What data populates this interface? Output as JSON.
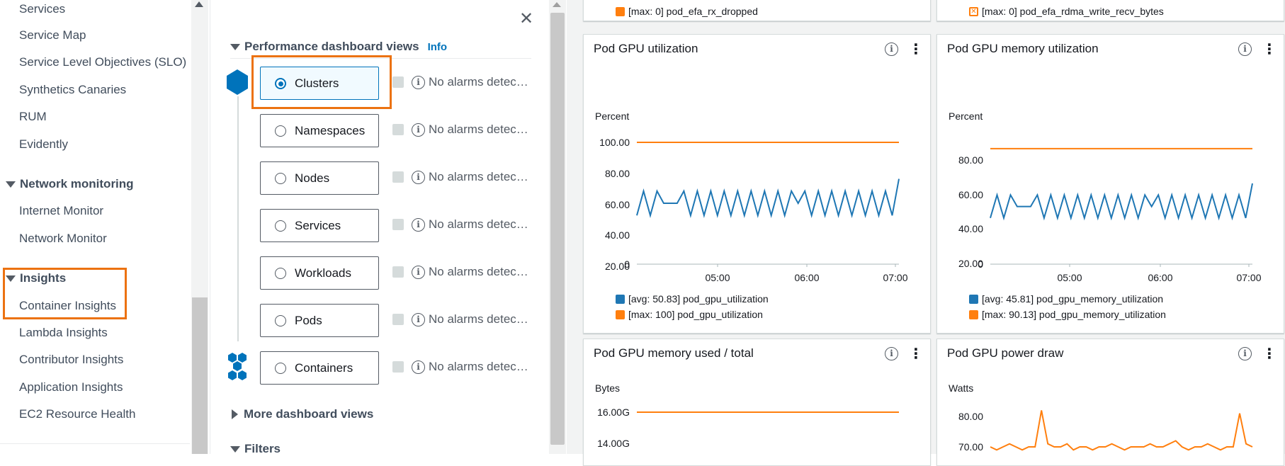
{
  "nav": {
    "items_top": [
      "Services",
      "Service Map",
      "Service Level Objectives (SLO)",
      "Synthetics Canaries",
      "RUM",
      "Evidently"
    ],
    "section_network": "Network monitoring",
    "items_network": [
      "Internet Monitor",
      "Network Monitor"
    ],
    "section_insights": "Insights",
    "items_insights": [
      "Container Insights",
      "Lambda Insights",
      "Contributor Insights",
      "Application Insights",
      "EC2 Resource Health"
    ]
  },
  "panel": {
    "close_glyph": "✕",
    "section_title": "Performance dashboard views",
    "info_link": "Info",
    "views": [
      {
        "label": "Clusters",
        "selected": true
      },
      {
        "label": "Namespaces",
        "selected": false
      },
      {
        "label": "Nodes",
        "selected": false
      },
      {
        "label": "Services",
        "selected": false
      },
      {
        "label": "Workloads",
        "selected": false
      },
      {
        "label": "Pods",
        "selected": false
      },
      {
        "label": "Containers",
        "selected": false
      }
    ],
    "alarm_text": "No alarms detec…",
    "more_views": "More dashboard views",
    "filters": "Filters"
  },
  "top_legends": {
    "left": "[max: 0] pod_efa_rx_dropped",
    "right": "[max: 0] pod_efa_rdma_write_recv_bytes"
  },
  "widgets": {
    "gpu_util": {
      "title": "Pod GPU utilization",
      "unit": "Percent",
      "legend_avg": "[avg: 50.83] pod_gpu_utilization",
      "legend_max": "[max: 100] pod_gpu_utilization"
    },
    "gpu_mem_util": {
      "title": "Pod GPU memory utilization",
      "unit": "Percent",
      "legend_avg": "[avg: 45.81] pod_gpu_memory_utilization",
      "legend_max": "[max: 90.13] pod_gpu_memory_utilization"
    },
    "gpu_mem_used": {
      "title": "Pod GPU memory used / total",
      "unit": "Bytes"
    },
    "gpu_power": {
      "title": "Pod GPU power draw",
      "unit": "Watts"
    }
  },
  "colors": {
    "blue": "#1f77b4",
    "orange": "#ff7f0e",
    "accent": "#0073bb",
    "highlight": "#ec7211"
  },
  "chart_data": [
    {
      "type": "line",
      "title": "Pod GPU utilization",
      "ylabel": "Percent",
      "yticks": [
        "100.00",
        "80.00",
        "60.00",
        "40.00",
        "20.00",
        "0"
      ],
      "xticks": [
        "05:00",
        "06:00",
        "07:00"
      ],
      "ylim": [
        0,
        100
      ],
      "series": [
        {
          "name": "[avg: 50.83] pod_gpu_utilization",
          "color": "#1f77b4",
          "values": [
            40,
            60,
            40,
            60,
            50,
            50,
            50,
            60,
            40,
            60,
            40,
            60,
            40,
            60,
            40,
            60,
            40,
            60,
            40,
            60,
            40,
            60,
            40,
            60,
            50,
            60,
            40,
            60,
            40,
            60,
            40,
            60,
            40,
            60,
            40,
            60,
            40,
            60,
            40,
            70
          ]
        },
        {
          "name": "[max: 100] pod_gpu_utilization",
          "color": "#ff7f0e",
          "values": [
            100,
            100
          ]
        }
      ]
    },
    {
      "type": "line",
      "title": "Pod GPU memory utilization",
      "ylabel": "Percent",
      "yticks": [
        "80.00",
        "60.00",
        "40.00",
        "20.00",
        "0"
      ],
      "xticks": [
        "05:00",
        "06:00",
        "07:00"
      ],
      "ylim": [
        0,
        100
      ],
      "series": [
        {
          "name": "[avg: 45.81] pod_gpu_memory_utilization",
          "color": "#1f77b4",
          "values": [
            36,
            54,
            36,
            54,
            45,
            45,
            45,
            54,
            36,
            54,
            36,
            54,
            36,
            54,
            36,
            54,
            36,
            54,
            36,
            54,
            36,
            54,
            36,
            54,
            45,
            54,
            36,
            54,
            36,
            54,
            36,
            54,
            36,
            54,
            36,
            54,
            36,
            54,
            36,
            63
          ]
        },
        {
          "name": "[max: 90.13] pod_gpu_memory_utilization",
          "color": "#ff7f0e",
          "values": [
            90.13,
            90.13
          ]
        }
      ]
    },
    {
      "type": "line",
      "title": "Pod GPU memory used / total",
      "ylabel": "Bytes",
      "yticks": [
        "16.00G",
        "14.00G"
      ],
      "series": [
        {
          "color": "#ff7f0e",
          "values": [
            16,
            16
          ]
        }
      ]
    },
    {
      "type": "line",
      "title": "Pod GPU power draw",
      "ylabel": "Watts",
      "yticks": [
        "80.00",
        "70.00"
      ],
      "series": [
        {
          "color": "#ff7f0e",
          "values": [
            70,
            69,
            70,
            71,
            70,
            69,
            70,
            70,
            82,
            71,
            70,
            70,
            71,
            69,
            70,
            70,
            69,
            70,
            70,
            71,
            70,
            69,
            70,
            70,
            70,
            71,
            70,
            70,
            71,
            72,
            70,
            69,
            70,
            70,
            71,
            70,
            69,
            70,
            70,
            81,
            71,
            70
          ]
        }
      ]
    }
  ]
}
